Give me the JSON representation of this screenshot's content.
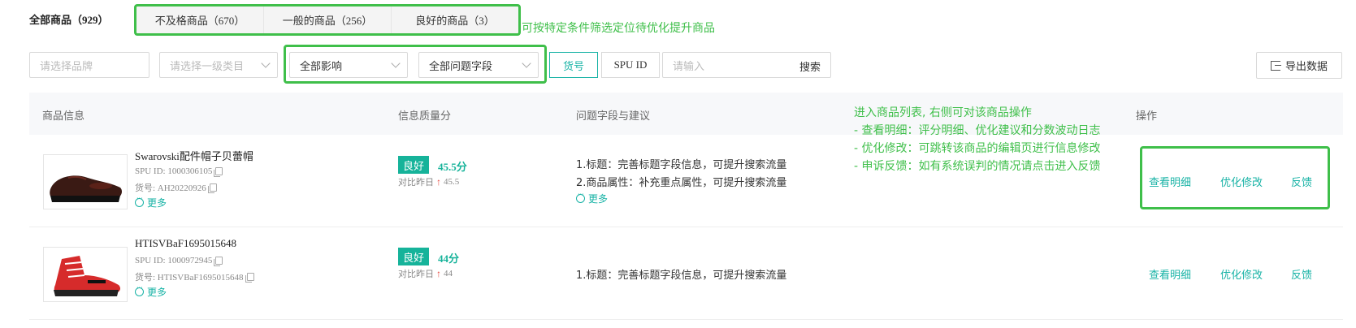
{
  "header": {
    "all_products_label": "全部商品（929）",
    "tabs": [
      {
        "label": "不及格商品（670）"
      },
      {
        "label": "一般的商品（256）"
      },
      {
        "label": "良好的商品（3）"
      }
    ],
    "annotation": "可按特定条件筛选定位待优化提升商品"
  },
  "filters": {
    "brand_placeholder": "请选择品牌",
    "category_placeholder": "请选择一级类目",
    "impact_value": "全部影响",
    "problem_field_value": "全部问题字段",
    "seg_goods_no": "货号",
    "seg_spu_id": "SPU ID",
    "search_placeholder": "请输入",
    "search_label": "搜索",
    "export_label": "导出数据"
  },
  "table": {
    "columns": [
      "商品信息",
      "信息质量分",
      "问题字段与建议",
      "操作"
    ],
    "annotation_lines": [
      "进入商品列表, 右侧可对该商品操作",
      "- 查看明细：评分明细、优化建议和分数波动日志",
      "- 优化修改：可跳转该商品的编辑页进行信息修改",
      "- 申诉反馈：如有系统误判的情况请点击进入反馈"
    ],
    "rows": [
      {
        "name": "Swarovski配件帽子贝蕾帽",
        "spu_id": "SPU ID: 1000306105",
        "goods_no": "货号: AH20220926",
        "more": "更多",
        "badge": "良好",
        "score": "45.5分",
        "compare_label": "对比昨日",
        "compare_value": "45.5",
        "suggestions": [
          "1.标题：完善标题字段信息，可提升搜索流量",
          "2.商品属性：补充重点属性，可提升搜索流量"
        ],
        "suggest_more": "更多",
        "ops": [
          "查看明细",
          "优化修改",
          "反馈"
        ]
      },
      {
        "name": "HTISVBaF1695015648",
        "spu_id": "SPU ID: 1000972945",
        "goods_no": "货号: HTISVBaF1695015648",
        "more": "更多",
        "badge": "良好",
        "score": "44分",
        "compare_label": "对比昨日",
        "compare_value": "44",
        "suggestions": [
          "1.标题：完善标题字段信息，可提升搜索流量"
        ],
        "ops": [
          "查看明细",
          "优化修改",
          "反馈"
        ]
      }
    ]
  },
  "colors": {
    "accent": "#19b3a6",
    "annotation_green": "#3fbf4a",
    "badge_bg": "#16b39a",
    "up_arrow": "#e5473e"
  }
}
